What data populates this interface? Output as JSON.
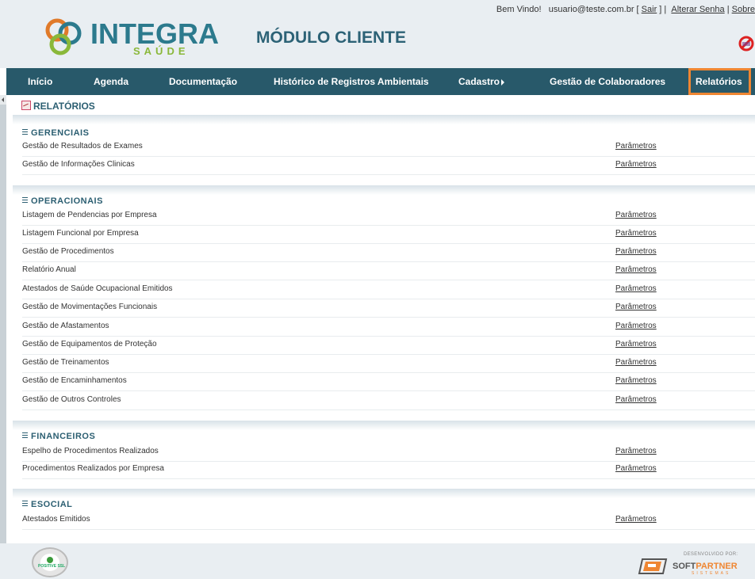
{
  "header": {
    "welcome": "Bem Vindo!",
    "user_email": "usuario@teste.com.br",
    "bracket_open": " [ ",
    "logout": "Sair",
    "bracket_close": " ] | ",
    "change_password": "Alterar Senha",
    "sep": " | ",
    "about": "Sobre",
    "logo_word": "INTEGRA",
    "logo_sub": "SAÚDE",
    "module_title": "MÓDULO CLIENTE"
  },
  "nav": {
    "items": [
      {
        "label": "Início"
      },
      {
        "label": "Agenda"
      },
      {
        "label": "Documentação"
      },
      {
        "label": "Histórico de Registros Ambientais"
      },
      {
        "label": "Cadastro"
      },
      {
        "label": "Gestão de Colaboradores"
      },
      {
        "label": "Relatórios"
      }
    ],
    "highlight_color": "#ef8632"
  },
  "page": {
    "heading": "RELATÓRIOS"
  },
  "sections": [
    {
      "title": "GERENCIAIS",
      "rows": [
        {
          "name": "Gestão de Resultados de Exames",
          "action": "Parâmetros"
        },
        {
          "name": "Gestão de Informações Clinicas",
          "action": "Parâmetros"
        }
      ]
    },
    {
      "title": "OPERACIONAIS",
      "rows": [
        {
          "name": "Listagem de Pendencias por Empresa",
          "action": "Parâmetros"
        },
        {
          "name": "Listagem Funcional por Empresa",
          "action": "Parâmetros"
        },
        {
          "name": "Gestão de Procedimentos",
          "action": "Parâmetros"
        },
        {
          "name": "Relatório Anual",
          "action": "Parâmetros"
        },
        {
          "name": "Atestados de Saúde Ocupacional Emitidos",
          "action": "Parâmetros"
        },
        {
          "name": "Gestão de Movimentações Funcionais",
          "action": "Parâmetros"
        },
        {
          "name": "Gestão de Afastamentos",
          "action": "Parâmetros"
        },
        {
          "name": "Gestão de Equipamentos de Proteção",
          "action": "Parâmetros"
        },
        {
          "name": "Gestão de Treinamentos",
          "action": "Parâmetros"
        },
        {
          "name": "Gestão de Encaminhamentos",
          "action": "Parâmetros"
        },
        {
          "name": "Gestão de Outros Controles",
          "action": "Parâmetros"
        }
      ]
    },
    {
      "title": "FINANCEIROS",
      "rows": [
        {
          "name": "Espelho de Procedimentos Realizados",
          "action": "Parâmetros"
        },
        {
          "name": "Procedimentos Realizados por Empresa",
          "action": "Parâmetros"
        }
      ]
    },
    {
      "title": "ESOCIAL",
      "rows": [
        {
          "name": "Atestados Emitidos",
          "action": "Parâmetros"
        }
      ]
    }
  ],
  "footer": {
    "seal_label": "POSITIVE SSL",
    "developed_by": "DESENVOLVIDO POR:",
    "vendor_a": "SOFT",
    "vendor_b": "PARTNER",
    "vendor_sub": "SISTEMAS"
  }
}
